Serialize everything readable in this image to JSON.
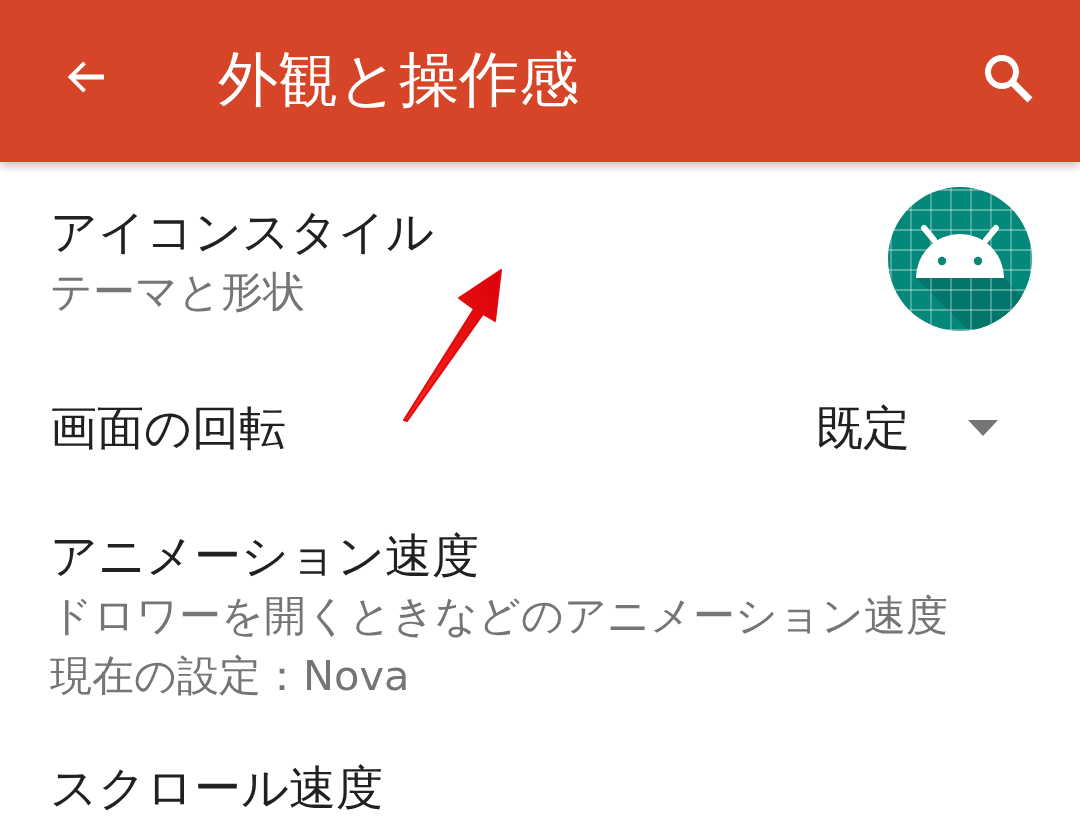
{
  "app_bar": {
    "title": "外観と操作感"
  },
  "settings": [
    {
      "kind": "icon",
      "title": "アイコンスタイル",
      "summary": "テーマと形状"
    },
    {
      "kind": "dropdown",
      "title": "画面の回転",
      "value": "既定"
    },
    {
      "kind": "text",
      "title": "アニメーション速度",
      "summary": "ドロワーを開くときなどのアニメーション速度",
      "detail": "現在の設定：Nova"
    },
    {
      "kind": "text",
      "title": "スクロール速度"
    }
  ]
}
